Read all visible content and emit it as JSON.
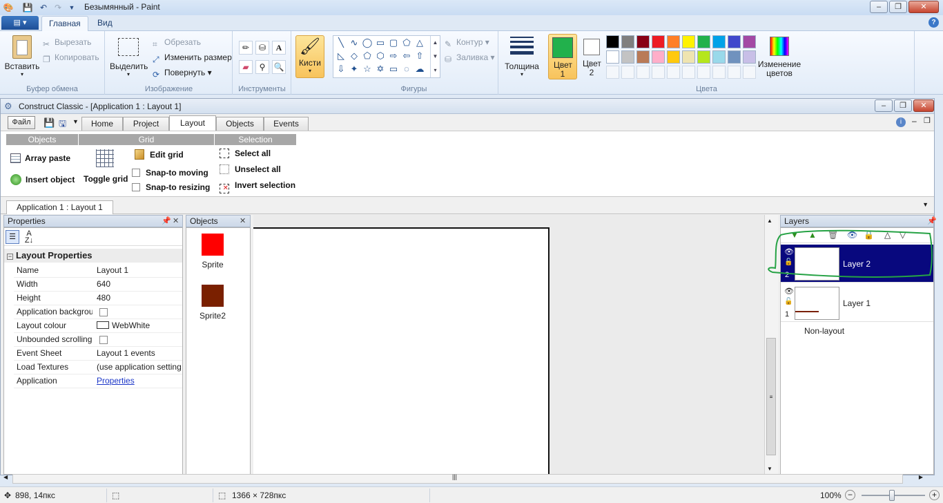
{
  "paint": {
    "window_title": "Безымянный - Paint",
    "tabs": [
      "Главная",
      "Вид"
    ],
    "active_tab": "Главная",
    "clipboard": {
      "paste": "Вставить",
      "cut": "Вырезать",
      "copy": "Копировать",
      "label": "Буфер обмена"
    },
    "image": {
      "select": "Выделить",
      "crop": "Обрезать",
      "resize": "Изменить размер",
      "rotate": "Повернуть",
      "label": "Изображение"
    },
    "tools": {
      "label": "Инструменты"
    },
    "brushes": {
      "label": "Кисти"
    },
    "shapes": {
      "outline": "Контур",
      "fill": "Заливка",
      "label": "Фигуры"
    },
    "thickness": {
      "label": "Толщина"
    },
    "color1": {
      "label": "Цвет 1",
      "hex": "#22b14c"
    },
    "color2": {
      "label": "Цвет 2",
      "hex": "#ffffff"
    },
    "colors": {
      "label": "Цвета",
      "edit_label": "Изменение цветов",
      "row1": [
        "#000000",
        "#7f7f7f",
        "#880015",
        "#ed1c24",
        "#ff7f27",
        "#fff200",
        "#22b14c",
        "#00a2e8",
        "#3f48cc",
        "#a349a4"
      ],
      "row2": [
        "#ffffff",
        "#c3c3c3",
        "#b97a57",
        "#ffaec9",
        "#ffc90e",
        "#efe4b0",
        "#b5e61d",
        "#99d9ea",
        "#7092be",
        "#c8bfe7"
      ]
    },
    "status": {
      "cursor_pos": "898, 14пкс",
      "canvas_size": "1366 × 728пкс",
      "zoom": "100%"
    }
  },
  "construct": {
    "window_title": "Construct Classic - [Application 1 : Layout 1]",
    "file_button": "Файл",
    "tabs": [
      "Home",
      "Project",
      "Layout",
      "Objects",
      "Events"
    ],
    "active_tab": "Layout",
    "ribbon": {
      "objects": {
        "label": "Objects",
        "array_paste": "Array paste",
        "insert_object": "Insert object"
      },
      "grid": {
        "label": "Grid",
        "toggle_grid": "Toggle grid",
        "edit_grid": "Edit grid",
        "snap_moving": "Snap-to moving",
        "snap_resizing": "Snap-to resizing"
      },
      "selection": {
        "label": "Selection",
        "select_all": "Select all",
        "unselect_all": "Unselect all",
        "invert_selection": "Invert selection"
      }
    },
    "doc_tab": "Application 1 : Layout 1",
    "properties": {
      "title": "Properties",
      "section": "Layout Properties",
      "rows": [
        {
          "name": "Name",
          "value": "Layout 1"
        },
        {
          "name": "Width",
          "value": "640"
        },
        {
          "name": "Height",
          "value": "480"
        },
        {
          "name": "Application backgrou",
          "value": ""
        },
        {
          "name": "Layout colour",
          "value": "WebWhite"
        },
        {
          "name": "Unbounded scrolling",
          "value": ""
        },
        {
          "name": "Event Sheet",
          "value": "Layout 1 events"
        },
        {
          "name": "Load Textures",
          "value": "(use application setting"
        },
        {
          "name": "Application",
          "value": "Properties"
        }
      ]
    },
    "objects_panel": {
      "title": "Objects",
      "items": [
        {
          "name": "Sprite",
          "color": "#ff0000"
        },
        {
          "name": "Sprite2",
          "color": "#7a2000"
        }
      ]
    },
    "layers": {
      "title": "Layers",
      "items": [
        {
          "name": "Layer 2",
          "num": "2",
          "selected": true
        },
        {
          "name": "Layer 1",
          "num": "1",
          "selected": false
        }
      ],
      "non_layout": "Non-layout"
    }
  }
}
